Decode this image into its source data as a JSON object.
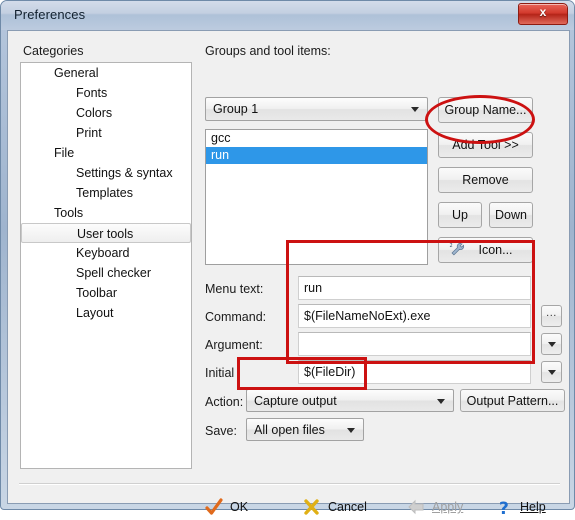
{
  "window": {
    "title": "Preferences",
    "close_label": "x"
  },
  "categories": {
    "heading": "Categories",
    "items": [
      {
        "label": "General",
        "level": 1,
        "selected": false
      },
      {
        "label": "Fonts",
        "level": 2,
        "selected": false
      },
      {
        "label": "Colors",
        "level": 2,
        "selected": false
      },
      {
        "label": "Print",
        "level": 2,
        "selected": false
      },
      {
        "label": "File",
        "level": 1,
        "selected": false
      },
      {
        "label": "Settings & syntax",
        "level": 2,
        "selected": false
      },
      {
        "label": "Templates",
        "level": 2,
        "selected": false
      },
      {
        "label": "Tools",
        "level": 1,
        "selected": false
      },
      {
        "label": "User tools",
        "level": 2,
        "selected": true
      },
      {
        "label": "Keyboard",
        "level": 2,
        "selected": false
      },
      {
        "label": "Spell checker",
        "level": 2,
        "selected": false
      },
      {
        "label": "Toolbar",
        "level": 2,
        "selected": false
      },
      {
        "label": "Layout",
        "level": 2,
        "selected": false
      }
    ]
  },
  "groups": {
    "heading": "Groups and tool items:",
    "group_combo": {
      "value": "Group 1",
      "options": [
        "Group 1"
      ]
    },
    "tool_items": [
      {
        "label": "gcc",
        "selected": false
      },
      {
        "label": "run",
        "selected": true
      }
    ],
    "buttons": {
      "group_name": "Group Name...",
      "add_tool": "Add Tool >>",
      "remove": "Remove",
      "up": "Up",
      "down": "Down",
      "icon": "Icon..."
    }
  },
  "details": {
    "menu_text_label": "Menu text:",
    "menu_text_value": "run",
    "command_label": "Command:",
    "command_value": "$(FileNameNoExt).exe",
    "argument_label": "Argument:",
    "argument_value": "",
    "initial_label": "Initial",
    "initial_value": "$(FileDir)",
    "browse_button": "...",
    "action_label": "Action:",
    "action_value": "Capture output",
    "action_options": [
      "Capture output"
    ],
    "output_pattern_button": "Output Pattern...",
    "save_label": "Save:",
    "save_value": "All open files",
    "save_options": [
      "All open files"
    ]
  },
  "footer": {
    "ok": "OK",
    "cancel": "Cancel",
    "apply": "Apply",
    "help": "Help"
  },
  "annotations": {
    "color": "#cc1111",
    "shapes": [
      {
        "type": "ellipse",
        "target": "add-tool-button"
      },
      {
        "type": "rectangle",
        "target": "detail-fields"
      },
      {
        "type": "rectangle",
        "target": "action-combo"
      }
    ]
  }
}
